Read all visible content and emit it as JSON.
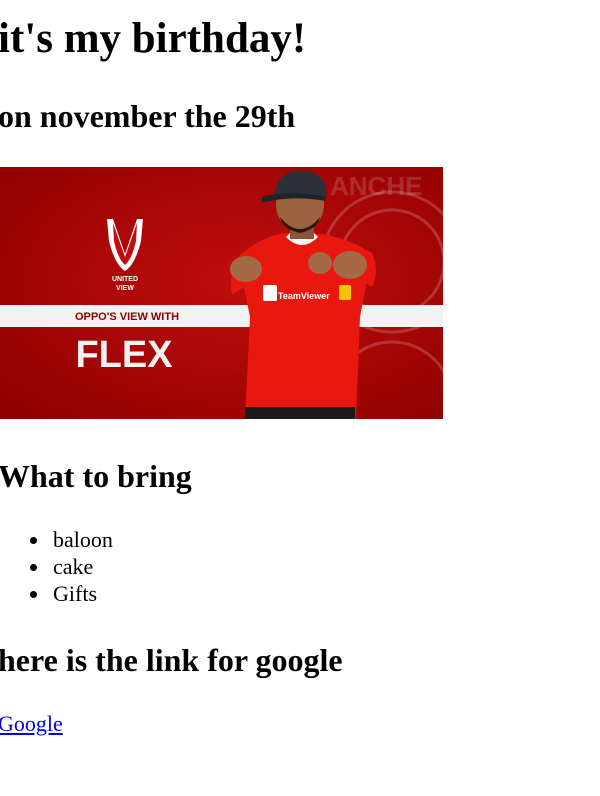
{
  "page": {
    "title": "it's my birthday!",
    "subtitle": "on november the 29th"
  },
  "banner": {
    "logo_text_1": "UNITED",
    "logo_text_2": "VIEW",
    "strip_text": "OPPO'S VIEW WITH",
    "big_text": "FLEX",
    "shirt_text": "TeamViewer",
    "colors": {
      "red": "#c10d0d",
      "dark_red": "#8f0000",
      "white": "#f2f2f2"
    }
  },
  "bring_section": {
    "heading": "What to bring",
    "items": [
      "baloon",
      "cake",
      "Gifts"
    ]
  },
  "link_section": {
    "heading": "here is the link for google",
    "link_label": "Google",
    "link_color": "#0000ee"
  }
}
